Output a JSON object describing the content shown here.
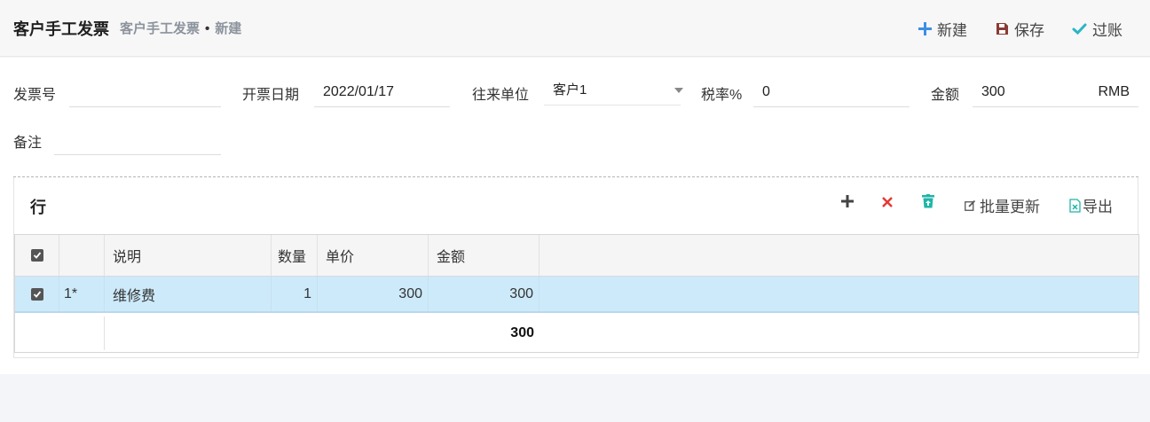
{
  "header": {
    "title": "客户手工发票",
    "breadcrumb_parent": "客户手工发票",
    "breadcrumb_sep": "•",
    "breadcrumb_current": "新建",
    "actions": {
      "new": "新建",
      "save": "保存",
      "post": "过账"
    }
  },
  "form": {
    "invoice_no_label": "发票号",
    "invoice_no_value": "",
    "date_label": "开票日期",
    "date_value": "2022/01/17",
    "partner_label": "往来单位",
    "partner_value": "客户1",
    "tax_label": "税率%",
    "tax_value": "0",
    "amount_label": "金额",
    "amount_value": "300",
    "currency": "RMB",
    "remark_label": "备注",
    "remark_value": ""
  },
  "lines": {
    "title": "行",
    "batch_update_label": "批量更新",
    "export_label": "导出",
    "columns": {
      "desc": "说明",
      "qty": "数量",
      "price": "单价",
      "amount": "金额"
    },
    "rows": [
      {
        "checked": true,
        "index": "1*",
        "desc": "维修费",
        "qty": "1",
        "price": "300",
        "amount": "300"
      }
    ],
    "total": "300"
  },
  "colors": {
    "accent_blue": "#3d8ee6",
    "save_icon": "#8a3b36",
    "post_icon": "#29b6c6",
    "delete_red": "#e53935",
    "row_selected": "#cdeafa"
  }
}
